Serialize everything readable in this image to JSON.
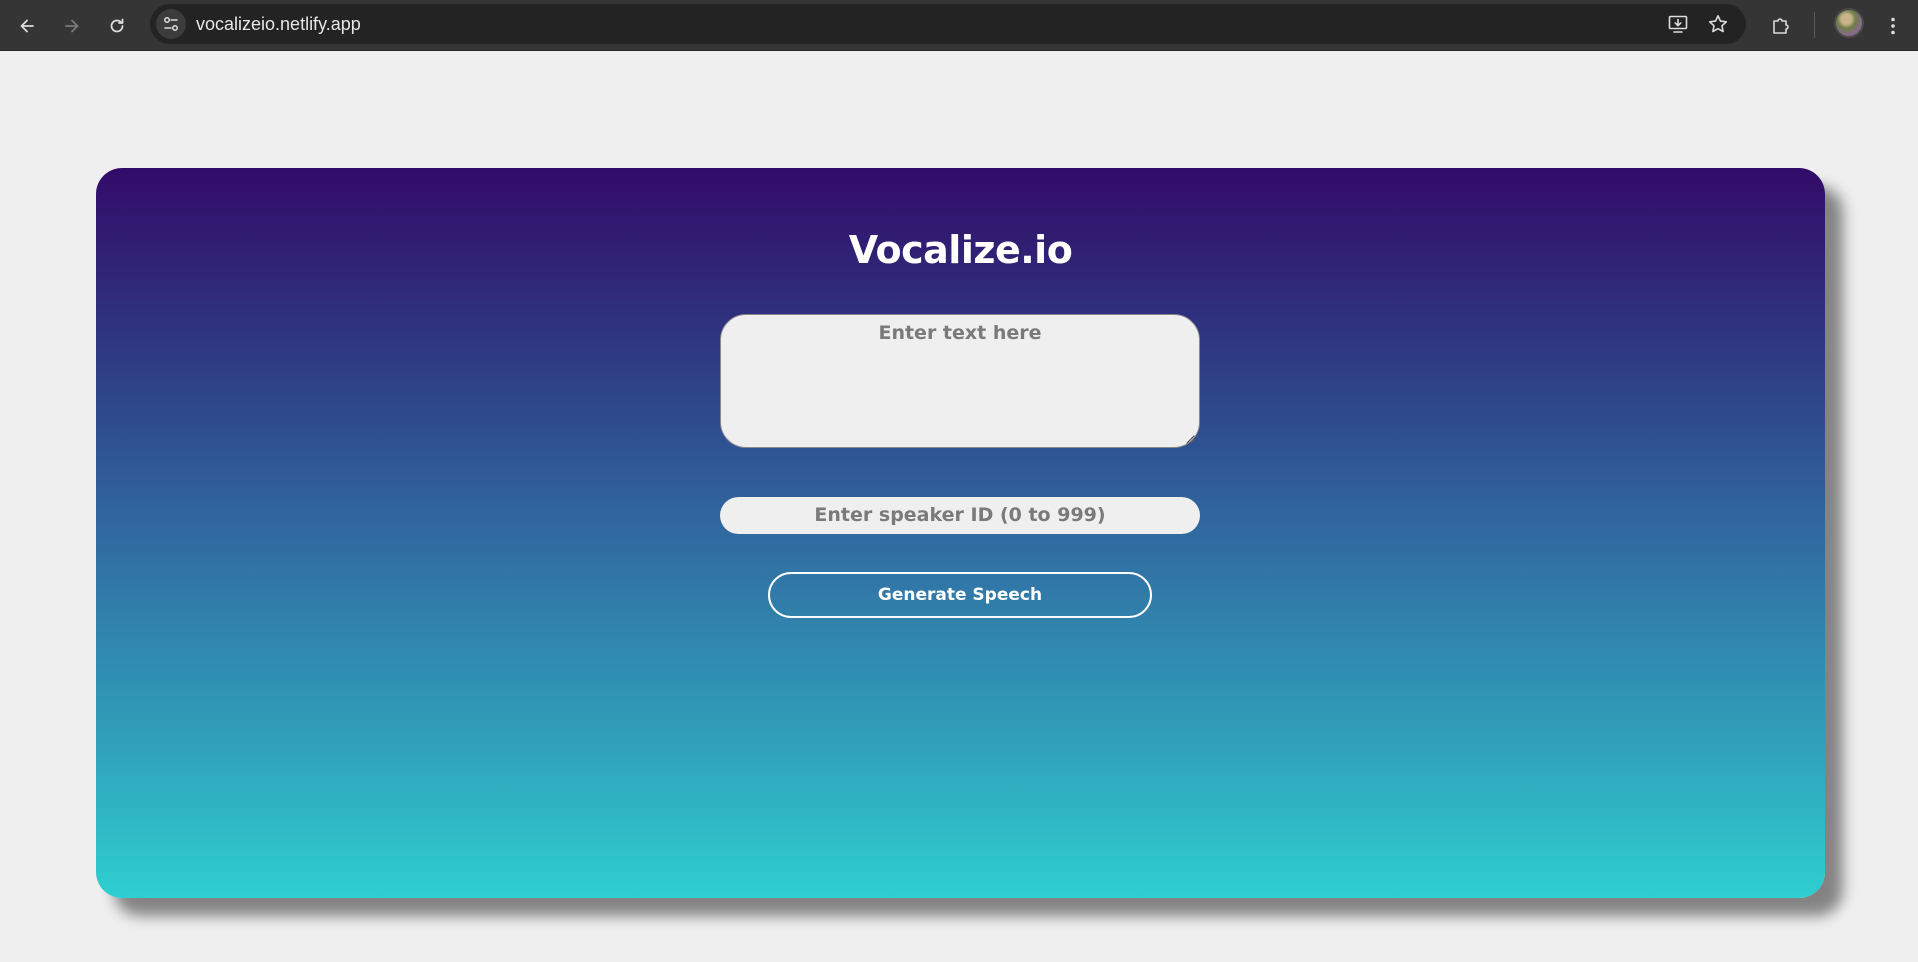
{
  "browser": {
    "url": "vocalizeio.netlify.app",
    "icons": {
      "back": "back-arrow-icon",
      "forward": "forward-arrow-icon",
      "reload": "reload-icon",
      "site_info": "site-settings-icon",
      "install": "install-app-icon",
      "bookmark": "star-icon",
      "extensions": "puzzle-icon",
      "menu": "kebab-menu-icon"
    }
  },
  "app": {
    "title": "Vocalize.io",
    "text_input": {
      "placeholder": "Enter text here",
      "value": ""
    },
    "speaker_input": {
      "placeholder": "Enter speaker ID (0 to 999)",
      "value": ""
    },
    "generate_label": "Generate Speech"
  },
  "colors": {
    "gradient_top": "#320b68",
    "gradient_bottom": "#2ecfd1",
    "page_background": "#efefef",
    "chrome_background": "#353535"
  }
}
